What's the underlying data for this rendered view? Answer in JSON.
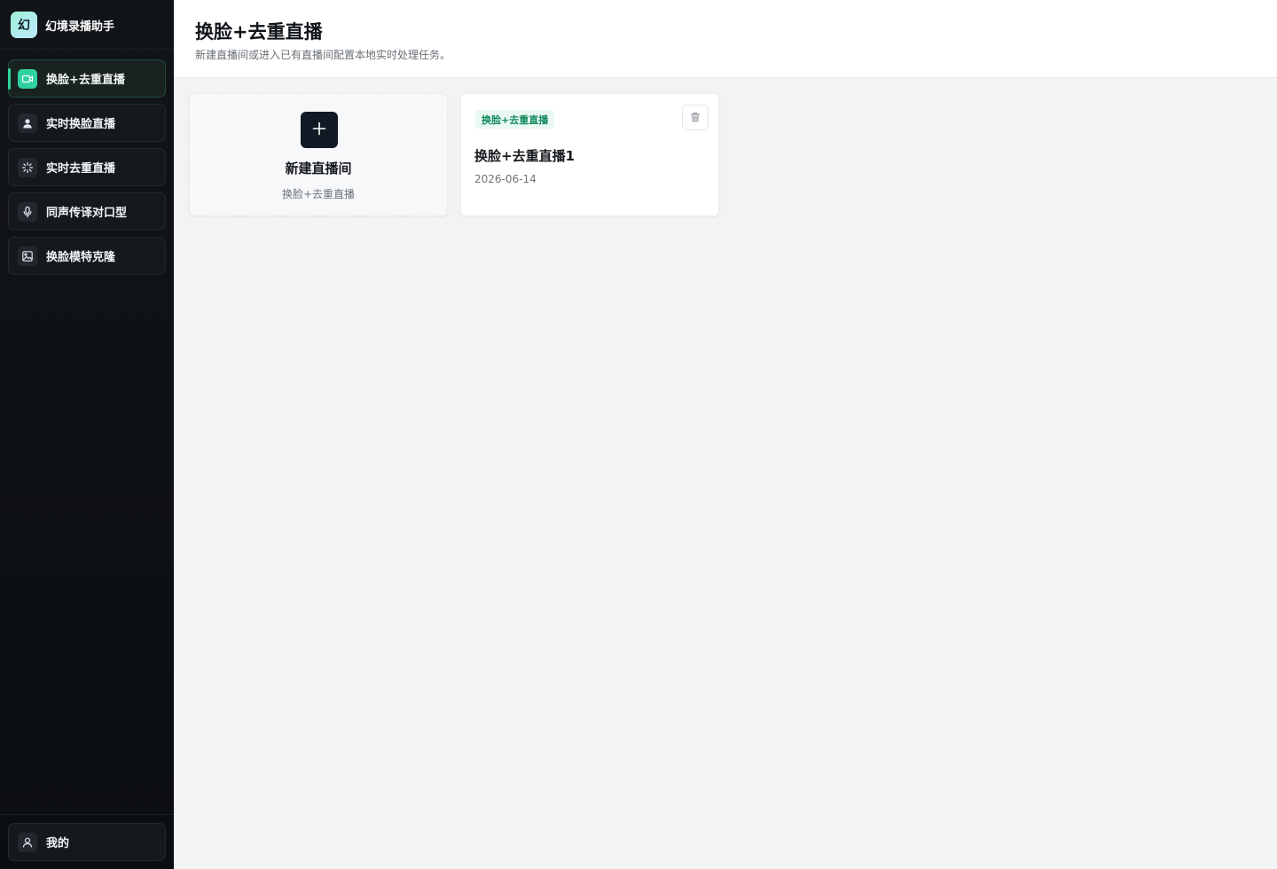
{
  "app": {
    "logo_char": "幻",
    "name": "幻境录播助手"
  },
  "sidebar": {
    "items": [
      {
        "label": "换脸+去重直播",
        "icon": "video-camera-icon",
        "active": true
      },
      {
        "label": "实时换脸直播",
        "icon": "person-icon",
        "active": false
      },
      {
        "label": "实时去重直播",
        "icon": "sparkle-icon",
        "active": false
      },
      {
        "label": "同声传译对口型",
        "icon": "microphone-icon",
        "active": false
      },
      {
        "label": "换脸模特克隆",
        "icon": "image-icon",
        "active": false
      }
    ],
    "user": {
      "label": "我的",
      "icon": "user-icon"
    }
  },
  "header": {
    "title": "换脸+去重直播",
    "subtitle": "新建直播间或进入已有直播间配置本地实时处理任务。"
  },
  "new_card": {
    "icon": "plus-icon",
    "title": "新建直播间",
    "subtitle": "换脸+去重直播"
  },
  "rooms": [
    {
      "tag": "换脸+去重直播",
      "name": "换脸+去重直播1",
      "date": "2026-06-14",
      "delete_icon": "trash-icon"
    }
  ],
  "colors": {
    "accent": "#2ed3a0",
    "sidebar_bg": "#0f1216",
    "tag_text": "#138a5e",
    "tag_bg": "#e9f9f2"
  }
}
